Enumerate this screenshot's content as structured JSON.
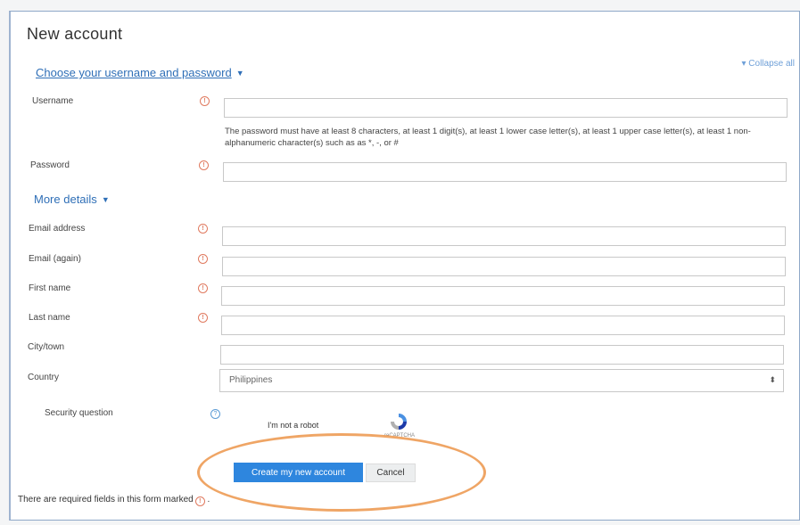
{
  "page": {
    "title": "New account",
    "collapse_all": "▾ Collapse all"
  },
  "sections": {
    "credentials": {
      "label": "Choose your username and password"
    },
    "details": {
      "label": "More details"
    }
  },
  "fields": {
    "username": {
      "label": "Username",
      "value": ""
    },
    "password_hint": "The password must have at least 8 characters, at least 1 digit(s), at least 1 lower case letter(s), at least 1 upper case letter(s), at least 1 non-alphanumeric character(s) such as as *, -, or #",
    "password": {
      "label": "Password",
      "value": ""
    },
    "email": {
      "label": "Email address",
      "value": ""
    },
    "email_again": {
      "label": "Email (again)",
      "value": ""
    },
    "first_name": {
      "label": "First name",
      "value": ""
    },
    "last_name": {
      "label": "Last name",
      "value": ""
    },
    "city": {
      "label": "City/town",
      "value": ""
    },
    "country": {
      "label": "Country",
      "selected": "Philippines"
    },
    "security_question": {
      "label": "Security question"
    }
  },
  "recaptcha": {
    "text": "I'm not a robot",
    "brand": "reCAPTCHA"
  },
  "actions": {
    "create_label": "Create my new account",
    "cancel_label": "Cancel"
  },
  "footer": {
    "required_note": "There are required fields in this form marked",
    "required_suffix": "."
  },
  "colors": {
    "accent": "#2e86de",
    "link": "#2f6fb7",
    "required": "#e07a5f",
    "annotation": "#efa565"
  },
  "icons": {
    "required": "exclamation-circle-icon",
    "help": "question-circle-icon",
    "collapse": "caret-down-icon",
    "select_arrow": "updown-arrow-icon"
  }
}
